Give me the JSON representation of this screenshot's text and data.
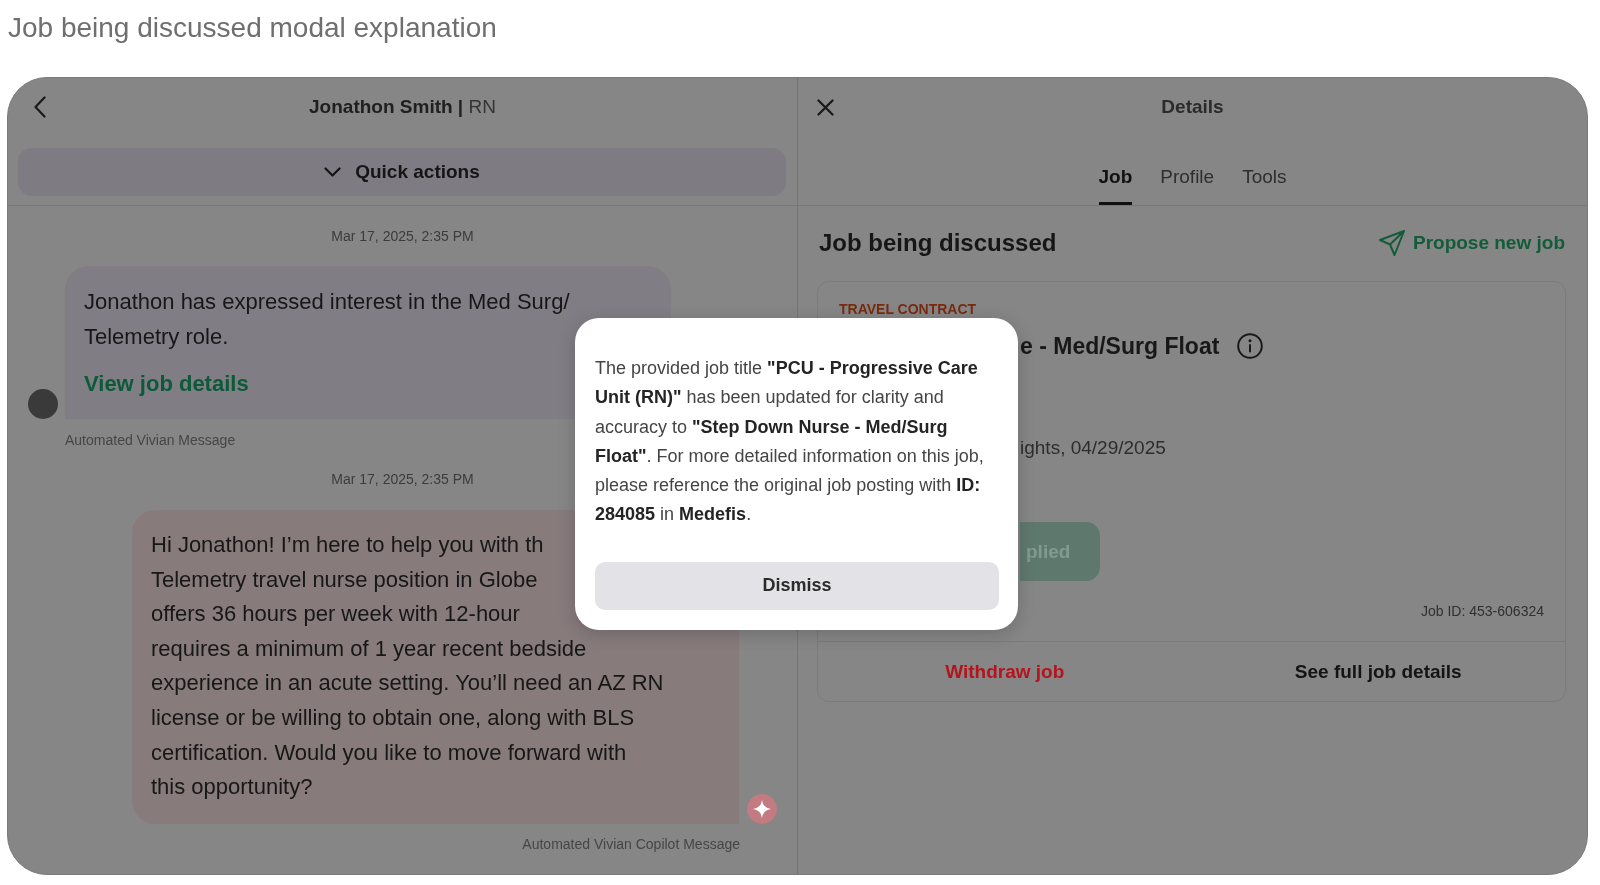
{
  "page_title": "Job being discussed modal explanation",
  "chat": {
    "title": "**Jonathon Smith |** RN",
    "quick_actions": {
      "label": "Quick actions",
      "expanded": false
    },
    "messages": [
      {
        "kind": "notice",
        "timestamp": "Mar 17, 2025, 2:35 PM",
        "text": "Jonathon has expressed interest in the Med Surg/ Telemetry role.",
        "link": "View job details",
        "footer": "Automated Vivian Message"
      },
      {
        "kind": "copilot",
        "timestamp": "Mar 17, 2025, 2:35 PM",
        "lines": [
          "Hi Jonathon! I’m here to help you with th",
          "Telemetry travel nurse position in Globe",
          "offers 36 hours per week with 12-hour",
          "requires a minimum of 1 year recent bedside",
          "experience in an acute setting. You’ll need an AZ RN",
          "license or be willing to obtain one, along with BLS",
          "certification. Would you like to move forward with",
          "this opportunity?"
        ],
        "footer": "Automated Vivian Copilot Message"
      }
    ]
  },
  "details": {
    "title": "Details",
    "tabs": [
      {
        "label": "Job",
        "selected": true
      },
      {
        "label": "Profile",
        "selected": false
      },
      {
        "label": "Tools",
        "selected": false
      }
    ],
    "section_title": "Job being discussed",
    "propose_action": "Propose new job",
    "job": {
      "contract_type": "TRAVEL CONTRACT",
      "title": "e - Med/Surg Float",
      "schedule": "ights, 04/29/2025",
      "status": "plied",
      "job_id": "Job ID: 453-606324",
      "actions": [
        {
          "kind": "destructive",
          "label": "Withdraw job"
        },
        {
          "kind": "primary",
          "label": "See full job details"
        }
      ]
    }
  },
  "modal": {
    "message": "The provided job title **\"PCU - Progressive Care Unit (RN)\"** has been updated for clarity and accuracy to **\"Step Down Nurse - Med/Surg Float\"**. For more detailed information on this job, please reference the original job posting with **ID: 284085** in **Medefis**.",
    "button": "Dismiss"
  }
}
